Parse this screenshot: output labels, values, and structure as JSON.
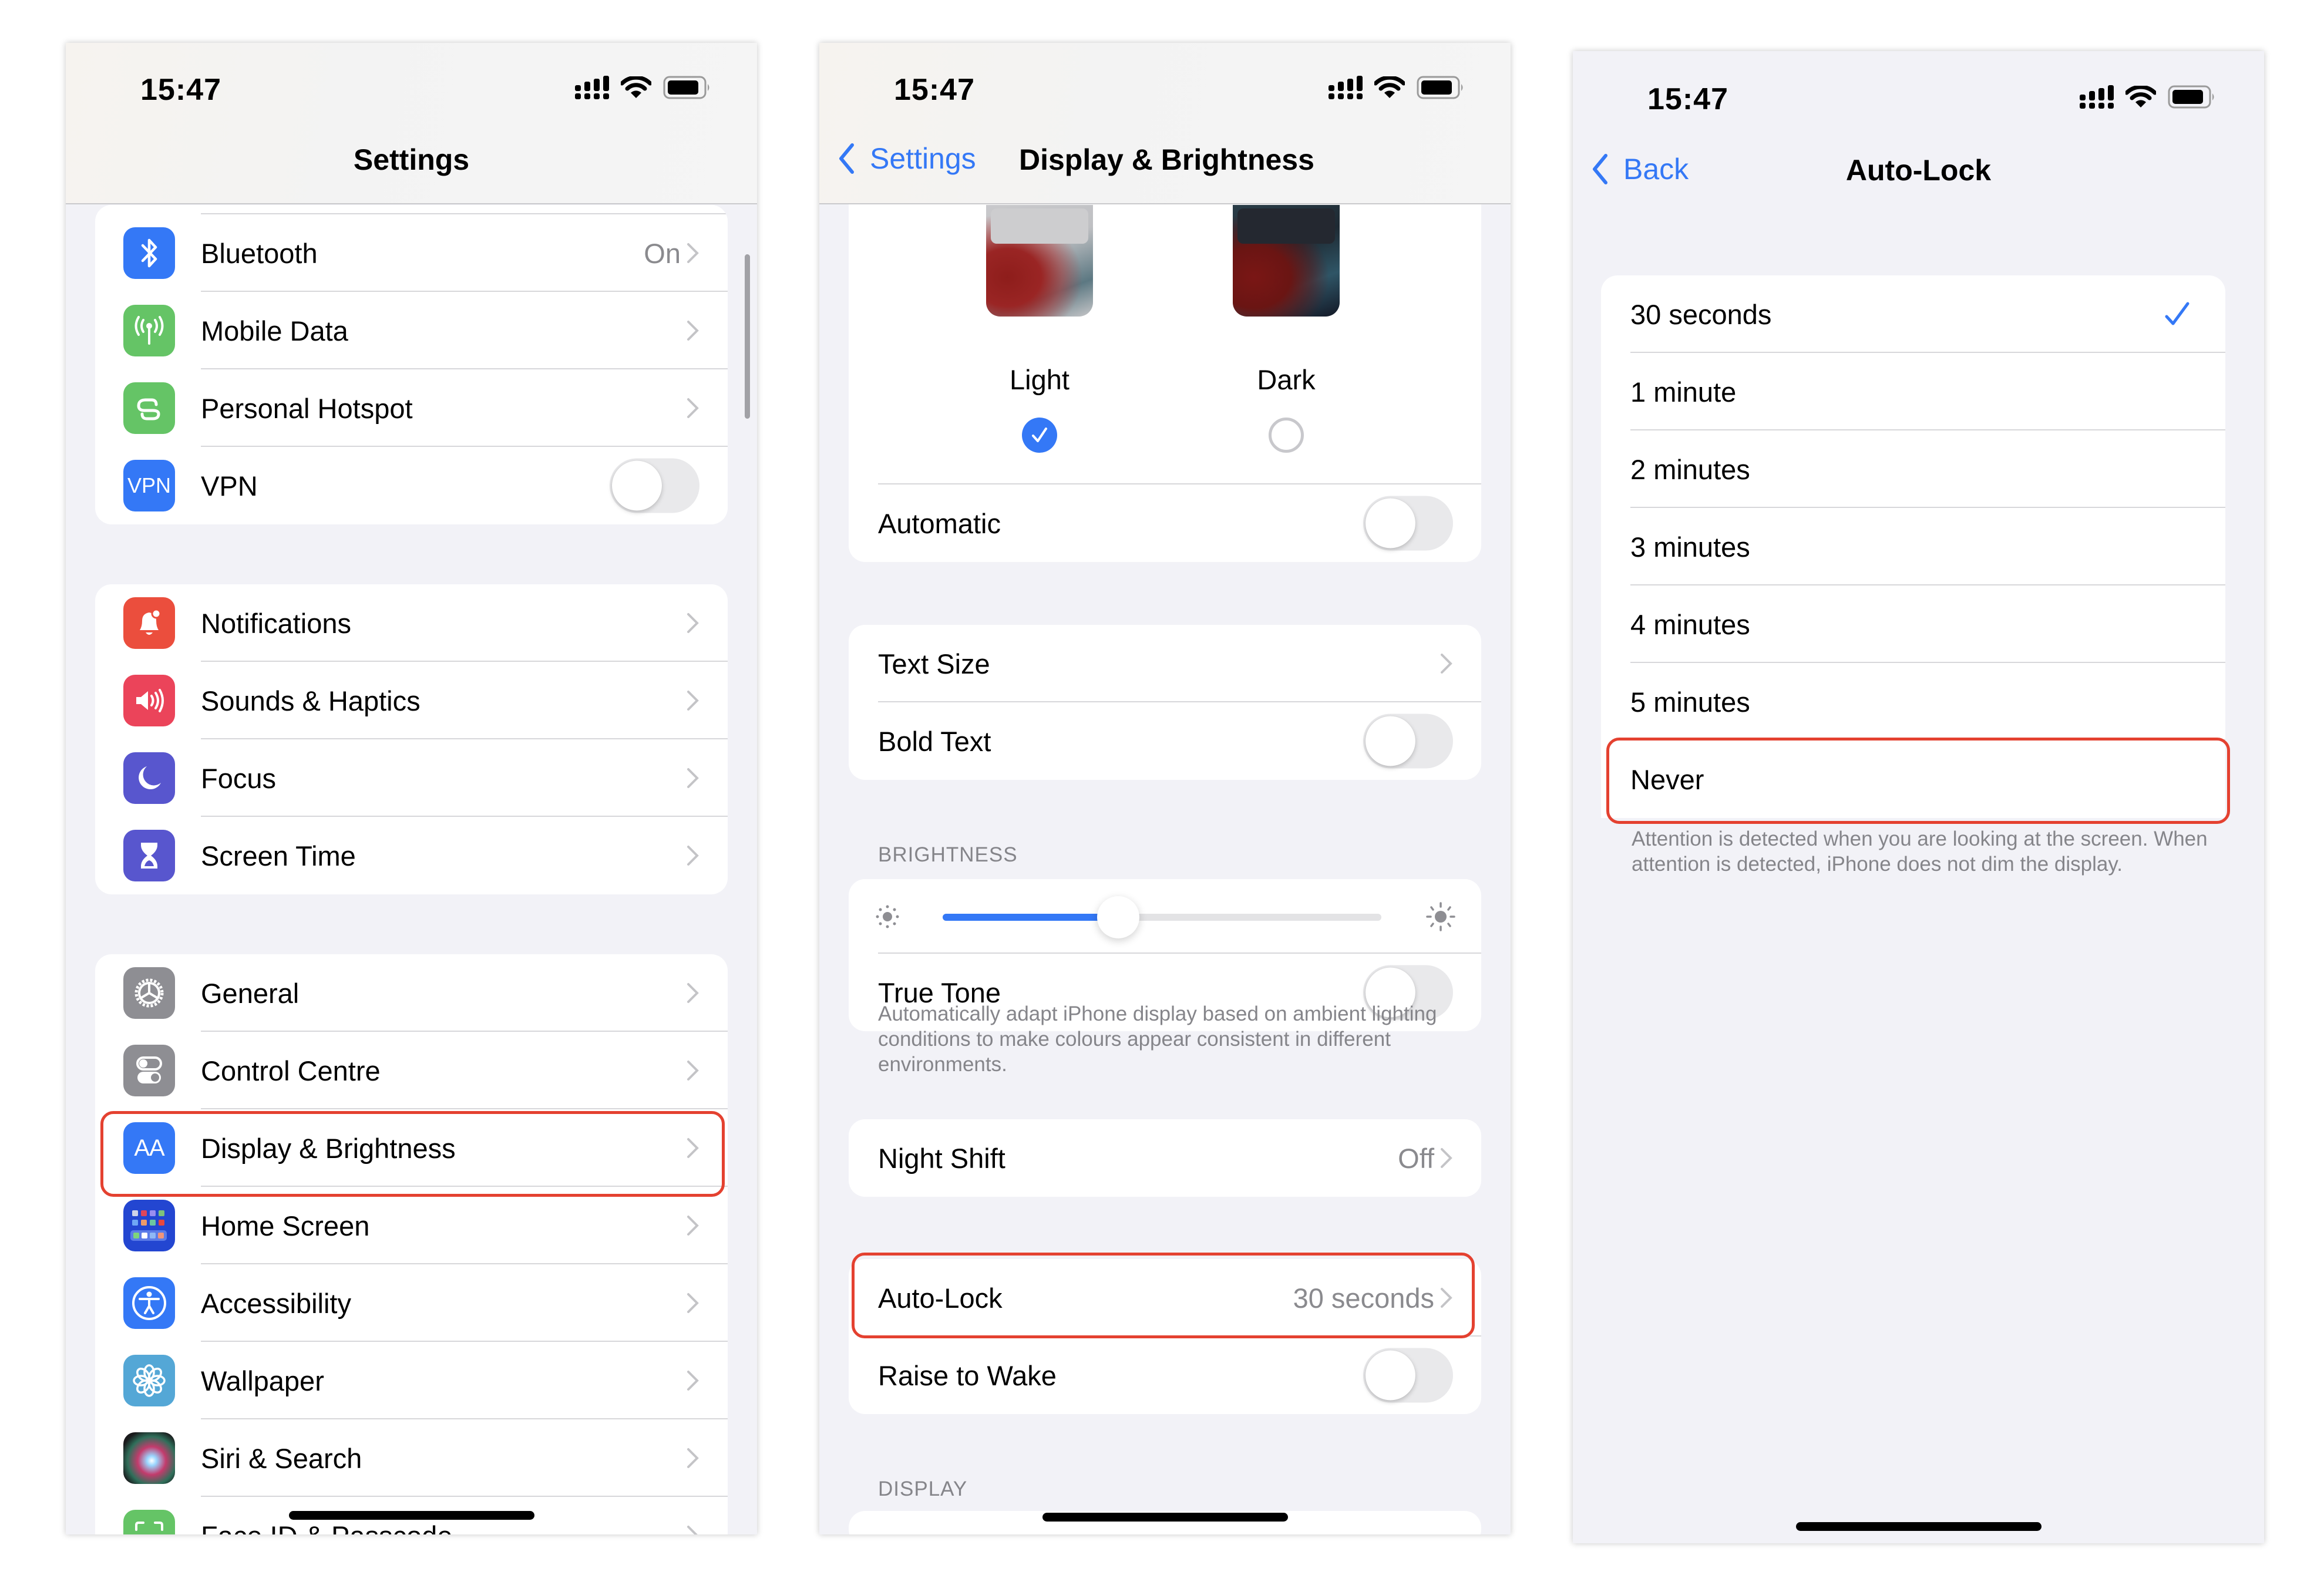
{
  "status_bar": {
    "time": "15:47"
  },
  "colors": {
    "accent": "#3478f6",
    "highlight": "#e44130",
    "secondary_text": "#8a8a8e"
  },
  "screen1": {
    "title": "Settings",
    "groups": [
      [
        {
          "label": "Bluetooth",
          "icon": "bluetooth-icon",
          "icon_color": "#3478f6",
          "value": "On",
          "accessory": "chevron"
        },
        {
          "label": "Mobile Data",
          "icon": "antenna-icon",
          "icon_color": "#65c466",
          "accessory": "chevron"
        },
        {
          "label": "Personal Hotspot",
          "icon": "hotspot-link-icon",
          "icon_color": "#65c466",
          "accessory": "chevron"
        },
        {
          "label": "VPN",
          "icon": "vpn-icon",
          "icon_text": "VPN",
          "icon_color": "#3478f6",
          "accessory": "toggle",
          "toggle_on": false
        }
      ],
      [
        {
          "label": "Notifications",
          "icon": "bell-icon",
          "icon_color": "#eb4e3d",
          "accessory": "chevron"
        },
        {
          "label": "Sounds & Haptics",
          "icon": "speaker-icon",
          "icon_color": "#eb445a",
          "accessory": "chevron"
        },
        {
          "label": "Focus",
          "icon": "moon-icon",
          "icon_color": "#5856ce",
          "accessory": "chevron"
        },
        {
          "label": "Screen Time",
          "icon": "hourglass-icon",
          "icon_color": "#5856ce",
          "accessory": "chevron"
        }
      ],
      [
        {
          "label": "General",
          "icon": "gear-icon",
          "icon_color": "#8e8e93",
          "accessory": "chevron"
        },
        {
          "label": "Control Centre",
          "icon": "switches-icon",
          "icon_color": "#8e8e93",
          "accessory": "chevron"
        },
        {
          "label": "Display & Brightness",
          "icon": "text-size-icon",
          "icon_text": "AA",
          "icon_color": "#3478f6",
          "accessory": "chevron",
          "highlighted": true
        },
        {
          "label": "Home Screen",
          "icon": "home-screen-grid-icon",
          "icon_color": "#2346d1",
          "accessory": "chevron"
        },
        {
          "label": "Accessibility",
          "icon": "accessibility-person-icon",
          "icon_color": "#3478f6",
          "accessory": "chevron"
        },
        {
          "label": "Wallpaper",
          "icon": "flower-icon",
          "icon_color": "#54a7d6",
          "accessory": "chevron"
        },
        {
          "label": "Siri & Search",
          "icon": "siri-orb-icon",
          "icon_color": "#1c1c1e",
          "accessory": "chevron"
        },
        {
          "label": "Face ID & Passcode",
          "icon": "face-id-icon",
          "icon_color": "#65c466",
          "accessory": "chevron",
          "partially_visible": true
        }
      ]
    ]
  },
  "screen2": {
    "back_label": "Settings",
    "title": "Display & Brightness",
    "appearance": {
      "options": [
        {
          "label": "Light",
          "selected": true
        },
        {
          "label": "Dark",
          "selected": false
        }
      ],
      "automatic_label": "Automatic",
      "automatic_on": false
    },
    "text_group": [
      {
        "label": "Text Size",
        "accessory": "chevron"
      },
      {
        "label": "Bold Text",
        "accessory": "toggle",
        "toggle_on": false
      }
    ],
    "brightness": {
      "header": "BRIGHTNESS",
      "level": 0.4,
      "true_tone_label": "True Tone",
      "true_tone_on": false,
      "footnote": "Automatically adapt iPhone display based on ambient lighting conditions to make colours appear consistent in different environments."
    },
    "night_shift": {
      "label": "Night Shift",
      "value": "Off"
    },
    "lock_group": [
      {
        "label": "Auto-Lock",
        "value": "30 seconds",
        "accessory": "chevron",
        "highlighted": true
      },
      {
        "label": "Raise to Wake",
        "accessory": "toggle",
        "toggle_on": false
      }
    ],
    "display_header": "DISPLAY"
  },
  "screen3": {
    "back_label": "Back",
    "title": "Auto-Lock",
    "options": [
      {
        "label": "30 seconds",
        "selected": true
      },
      {
        "label": "1 minute",
        "selected": false
      },
      {
        "label": "2 minutes",
        "selected": false
      },
      {
        "label": "3 minutes",
        "selected": false
      },
      {
        "label": "4 minutes",
        "selected": false
      },
      {
        "label": "5 minutes",
        "selected": false
      },
      {
        "label": "Never",
        "selected": false,
        "highlighted": true
      }
    ],
    "footnote": "Attention is detected when you are looking at the screen. When attention is detected, iPhone does not dim the display."
  }
}
